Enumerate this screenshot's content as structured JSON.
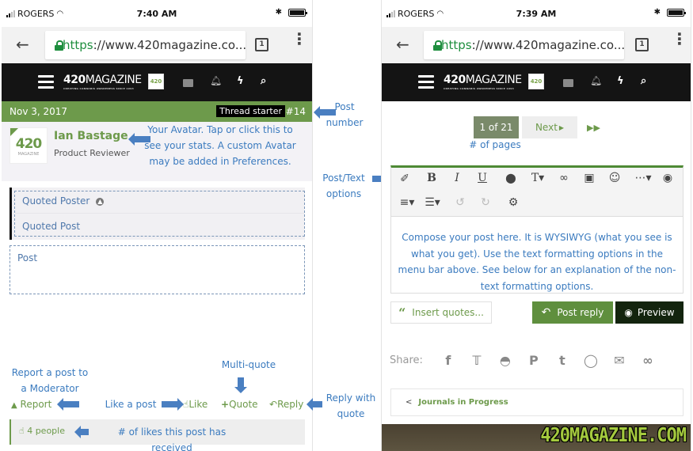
{
  "left_phone": {
    "status": {
      "carrier": "ROGERS",
      "time": "7:40 AM"
    },
    "browser": {
      "url_scheme": "https",
      "url_rest": "://www.420magazine.co...",
      "tab_count": "1"
    },
    "site": {
      "logo_main": "420",
      "logo_word": "MAGAZINE",
      "logo_tagline": "CREATING CANNABIS AWARENESS SINCE 1993",
      "logo_square": "420"
    },
    "post": {
      "date": "Nov 3, 2017",
      "badge": "Thread starter",
      "number": "#14",
      "username": "Ian Bastage",
      "user_title": "Product Reviewer",
      "avatar_text": "420",
      "avatar_sub": "MAGAZINE",
      "quoted_poster": "Quoted Poster",
      "quoted_post": "Quoted Post",
      "body": "Post",
      "actions": {
        "report": "Report",
        "like": "Like",
        "quote": "Quote",
        "reply": "Reply"
      },
      "likes": "4 people"
    }
  },
  "right_phone": {
    "status": {
      "carrier": "ROGERS",
      "time": "7:39 AM"
    },
    "browser": {
      "url_scheme": "https",
      "url_rest": "://www.420magazine.co...",
      "tab_count": "1"
    },
    "pager": {
      "current": "1 of 21",
      "next": "Next"
    },
    "editor": {
      "toolbar_icons": [
        "eraser-icon",
        "bold-icon",
        "italic-icon",
        "underline-icon",
        "color-icon",
        "text-size-icon",
        "link-icon",
        "image-icon",
        "smiley-icon",
        "more-icon",
        "camera-icon",
        "align-icon",
        "list-icon",
        "undo-icon",
        "redo-icon",
        "settings-icon"
      ],
      "placeholder": "Compose your post here. It is WYSIWYG (what you see is what you get). Use the text formatting options in the menu bar above. See below for an explanation of the non-text formatting options."
    },
    "buttons": {
      "insert_quotes": "Insert quotes...",
      "post_reply": "Post reply",
      "preview": "Preview"
    },
    "share": {
      "label": "Share:",
      "networks": [
        "facebook",
        "twitter",
        "reddit",
        "pinterest",
        "tumblr",
        "whatsapp",
        "email",
        "link"
      ]
    },
    "breadcrumb": "Journals in Progress",
    "banner": "420MAGAZINE.COM"
  },
  "annotations": {
    "post_number": "Post number",
    "avatar": "Your Avatar. Tap or click this to see your stats. A custom Avatar may be added in Preferences.",
    "post_text_options": "Post/Text options",
    "pages": "# of pages",
    "report": "Report a post to a Moderator",
    "like": "Like a post",
    "multi_quote": "Multi-quote",
    "reply_quote": "Reply with quote",
    "likes_received": "# of likes this post has received"
  },
  "colors": {
    "brand_green": "#6d9a4b",
    "annotation_blue": "#3b7bbf",
    "nav_black": "#141414"
  }
}
